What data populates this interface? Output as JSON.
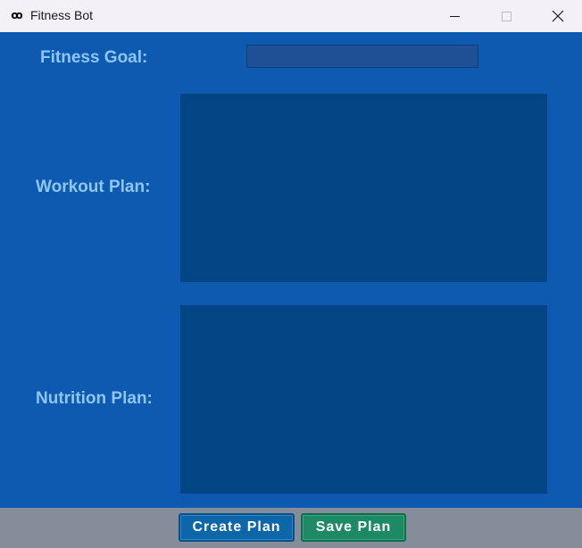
{
  "window": {
    "title": "Fitness Bot",
    "icon": "app-logo-icon",
    "icon_glyph": "ꝏ",
    "controls": {
      "minimize": "minimize-icon",
      "maximize": "maximize-icon",
      "close_glyph": "✕"
    }
  },
  "form": {
    "goal_label": "Fitness Goal:",
    "goal_value": "",
    "workout_label": "Workout Plan:",
    "workout_value": "",
    "nutrition_label": "Nutrition Plan:",
    "nutrition_value": ""
  },
  "actions": {
    "create_label": "Create Plan",
    "save_label": "Save Plan"
  },
  "colors": {
    "background": "#0d5ab0",
    "label": "#8ec6f3",
    "text_area": "#044586",
    "input": "#1f4f94",
    "bottom_bar": "#858c9a",
    "create_button": "#0d66a8",
    "save_button": "#1d8a65"
  }
}
